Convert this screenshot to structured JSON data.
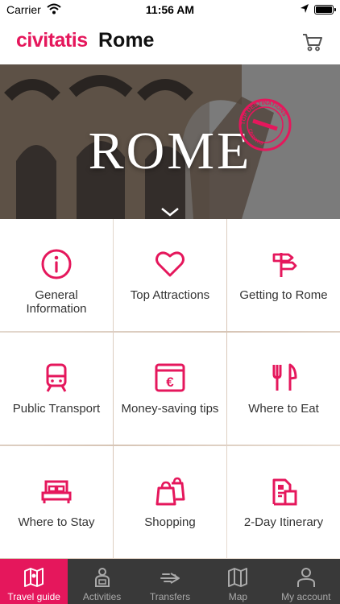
{
  "status": {
    "carrier": "Carrier",
    "time": "11:56 AM"
  },
  "header": {
    "brand": "civitatis",
    "city": "Rome"
  },
  "hero": {
    "title": "ROME",
    "stamp_top": "TOP DESTINATIONS",
    "stamp_bottom": "CIVITATIS"
  },
  "colors": {
    "accent": "#e5175c",
    "tabbar": "#393939"
  },
  "tiles": [
    {
      "label": "General Information",
      "icon": "info-icon"
    },
    {
      "label": "Top Attractions",
      "icon": "heart-icon"
    },
    {
      "label": "Getting to Rome",
      "icon": "signpost-icon"
    },
    {
      "label": "Public Transport",
      "icon": "train-icon"
    },
    {
      "label": "Money-saving tips",
      "icon": "euro-icon"
    },
    {
      "label": "Where to Eat",
      "icon": "fork-knife-icon"
    },
    {
      "label": "Where to Stay",
      "icon": "bed-icon"
    },
    {
      "label": "Shopping",
      "icon": "shopping-bags-icon"
    },
    {
      "label": "2-Day Itinerary",
      "icon": "itinerary-icon"
    }
  ],
  "tabs": [
    {
      "label": "Travel guide",
      "icon": "map-guide-icon",
      "active": true
    },
    {
      "label": "Activities",
      "icon": "activities-icon"
    },
    {
      "label": "Transfers",
      "icon": "transfers-icon"
    },
    {
      "label": "Map",
      "icon": "map-icon"
    },
    {
      "label": "My account",
      "icon": "user-icon"
    }
  ]
}
